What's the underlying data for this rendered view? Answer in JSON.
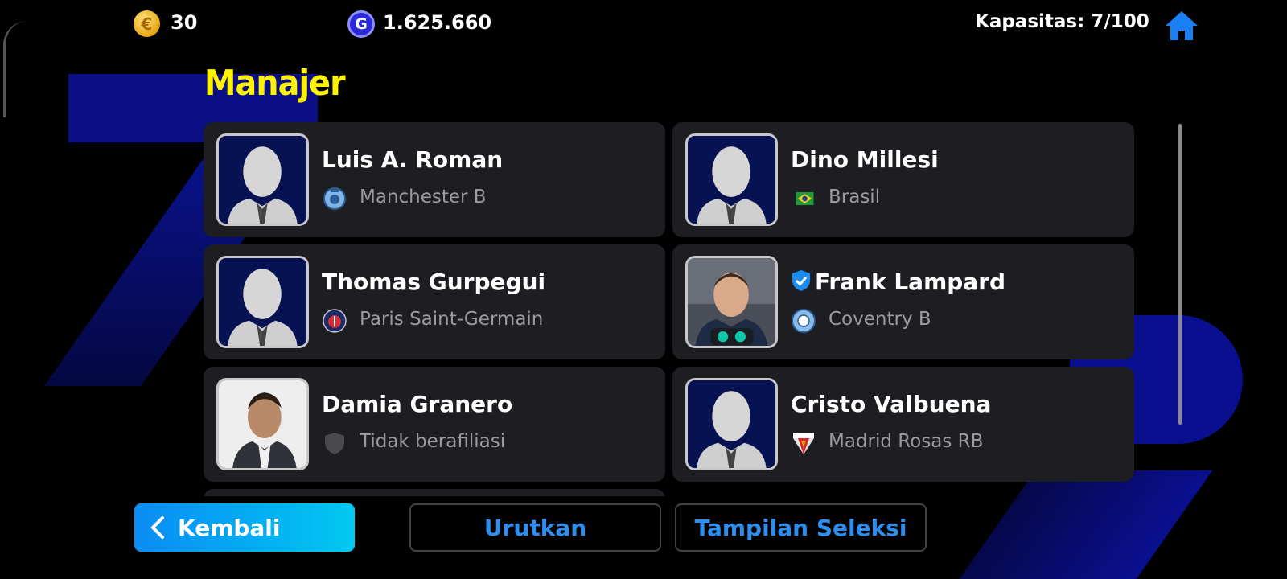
{
  "header": {
    "coins": "30",
    "gp": "1.625.660",
    "capacity": "Kapasitas: 7/100"
  },
  "title": "Manajer",
  "managers": [
    {
      "name": "Luis A. Roman",
      "club": "Manchester B",
      "club_icon": "manchester-b-crest",
      "portrait": "silhouette",
      "verified": false
    },
    {
      "name": "Dino Millesi",
      "club": "Brasil",
      "club_icon": "brazil-flag",
      "portrait": "silhouette",
      "verified": false
    },
    {
      "name": "Thomas Gurpegui",
      "club": "Paris Saint-Germain",
      "club_icon": "psg-crest",
      "portrait": "silhouette",
      "verified": false
    },
    {
      "name": "Frank Lampard",
      "club": "Coventry B",
      "club_icon": "coventry-crest",
      "portrait": "photo",
      "verified": true
    },
    {
      "name": "Damia Granero",
      "club": "Tidak berafiliasi",
      "club_icon": "unaffiliated-shield",
      "portrait": "photo",
      "verified": false
    },
    {
      "name": "Cristo Valbuena",
      "club": "Madrid Rosas RB",
      "club_icon": "madrid-rosas-crest",
      "portrait": "silhouette",
      "verified": false
    }
  ],
  "buttons": {
    "back": "Kembali",
    "sort": "Urutkan",
    "selection_view": "Tampilan Seleksi"
  },
  "colors": {
    "title": "#fff200",
    "accent_blue": "#2d8ef0",
    "card_bg": "#1d1d22",
    "background": "#000000"
  }
}
